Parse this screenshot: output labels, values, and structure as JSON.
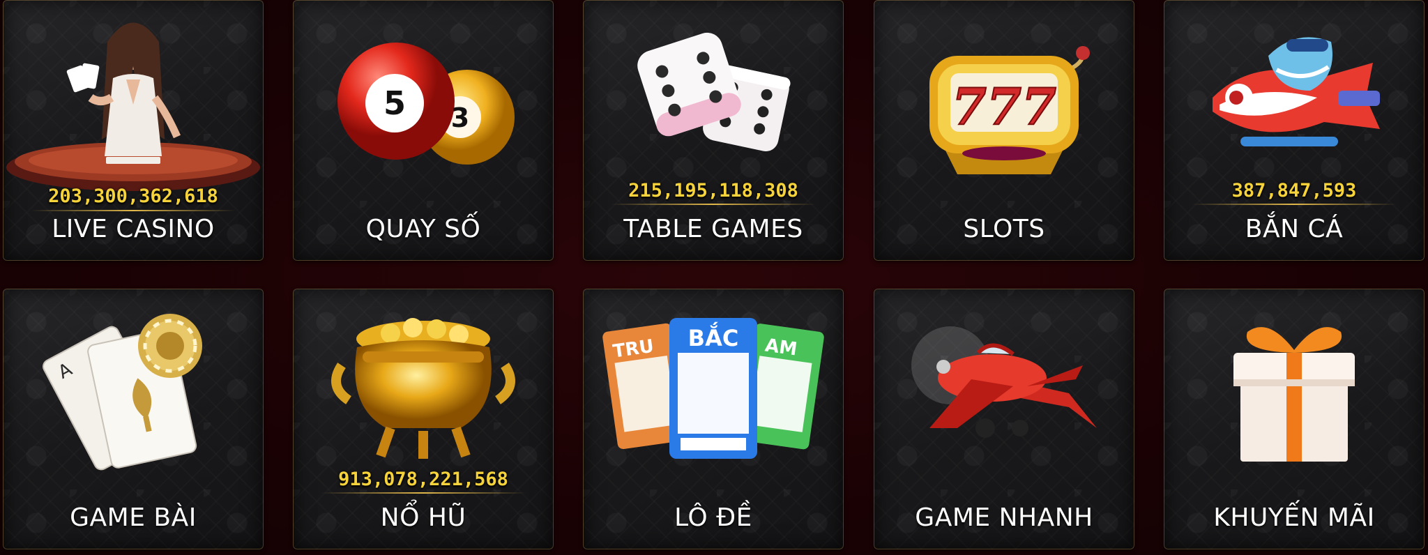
{
  "tiles": [
    {
      "label": "LIVE CASINO",
      "jackpot": "203,300,362,618",
      "icon": "live-dealer-icon"
    },
    {
      "label": "QUAY SỐ",
      "jackpot": "",
      "icon": "lottery-balls-icon",
      "balls": [
        "5",
        "3"
      ]
    },
    {
      "label": "TABLE GAMES",
      "jackpot": "215,195,118,308",
      "icon": "dice-icon"
    },
    {
      "label": "SLOTS",
      "jackpot": "",
      "icon": "slot-machine-icon",
      "slot_text": "777"
    },
    {
      "label": "BẮN CÁ",
      "jackpot": "387,847,593",
      "icon": "fish-shooter-icon"
    },
    {
      "label": "GAME BÀI",
      "jackpot": "",
      "icon": "playing-cards-icon"
    },
    {
      "label": "NỔ HŨ",
      "jackpot": "913,078,221,568",
      "icon": "gold-pot-icon"
    },
    {
      "label": "LÔ ĐỀ",
      "jackpot": "",
      "icon": "lottery-tickets-icon",
      "tickets": [
        "TRU",
        "BẮC",
        "AM"
      ]
    },
    {
      "label": "GAME NHANH",
      "jackpot": "",
      "icon": "airplane-icon"
    },
    {
      "label": "KHUYẾN MÃI",
      "jackpot": "",
      "icon": "gift-box-icon"
    }
  ],
  "colors": {
    "jackpot": "#f6d33a",
    "label": "#ffffff",
    "tile_border": "#c8a05a",
    "background": "#1a0204"
  }
}
